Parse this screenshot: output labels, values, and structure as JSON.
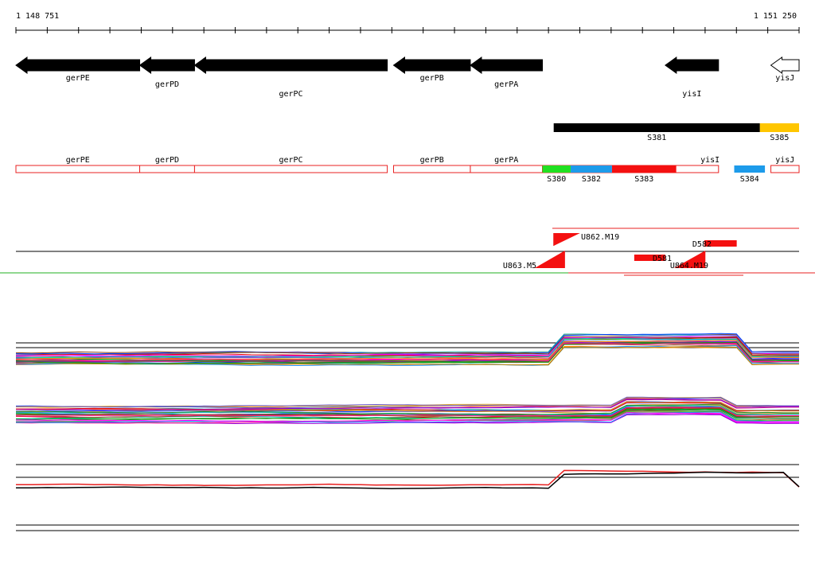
{
  "ruler": {
    "start_label": "1 148 751",
    "end_label": "1 151 250",
    "start": 1148751,
    "end": 1151250
  },
  "genes": [
    {
      "name": "gerPE",
      "start": 1148751,
      "end": 1149146,
      "strand": "-",
      "fill": "#000000"
    },
    {
      "name": "gerPD",
      "start": 1149146,
      "end": 1149321,
      "strand": "-",
      "fill": "#000000"
    },
    {
      "name": "gerPC",
      "start": 1149321,
      "end": 1149936,
      "strand": "-",
      "fill": "#000000"
    },
    {
      "name": "gerPB",
      "start": 1149956,
      "end": 1150201,
      "strand": "-",
      "fill": "#000000"
    },
    {
      "name": "gerPA",
      "start": 1150201,
      "end": 1150431,
      "strand": "-",
      "fill": "#000000"
    },
    {
      "name": "yisI",
      "start": 1150823,
      "end": 1150993,
      "strand": "-",
      "fill": "#000000"
    },
    {
      "name": "yisJ",
      "start": 1151160,
      "end": 1151250,
      "strand": "-",
      "fill": "#ffffff"
    }
  ],
  "segments_top": [
    {
      "name": "S381",
      "start": 1150467,
      "end": 1151125,
      "color": "#000000"
    },
    {
      "name": "S385",
      "start": 1151125,
      "end": 1151250,
      "color": "#ffc600"
    }
  ],
  "gene_boxes": [
    {
      "name": "gerPE",
      "start": 1148751,
      "end": 1149146
    },
    {
      "name": "gerPD",
      "start": 1149146,
      "end": 1149321
    },
    {
      "name": "gerPC",
      "start": 1149321,
      "end": 1149936
    },
    {
      "name": "gerPB",
      "start": 1149956,
      "end": 1150201
    },
    {
      "name": "gerPA",
      "start": 1150201,
      "end": 1150431
    },
    {
      "name": "yisI",
      "start": 1150431,
      "end": 1150993
    },
    {
      "name": "yisJ",
      "start": 1151160,
      "end": 1151250
    }
  ],
  "segments": [
    {
      "name": "S380",
      "start": 1150431,
      "end": 1150521,
      "color": "#21e021"
    },
    {
      "name": "S382",
      "start": 1150521,
      "end": 1150653,
      "color": "#1d9bea"
    },
    {
      "name": "S383",
      "start": 1150653,
      "end": 1150858,
      "color": "#f41010"
    },
    {
      "name": "S384",
      "start": 1151043,
      "end": 1151141,
      "color": "#1d9bea"
    }
  ],
  "probes": [
    {
      "name": "U862.M19",
      "start": 1150467,
      "end": 1150551
    },
    {
      "name": "D582",
      "start": 1150948,
      "end": 1151051
    },
    {
      "name": "D581",
      "start": 1150724,
      "end": 1150823
    },
    {
      "name": "U863.M5",
      "start": 1150406,
      "end": 1150503
    },
    {
      "name": "U864.M19",
      "start": 1150851,
      "end": 1150951
    }
  ],
  "profile_lines": {
    "red": "#e82020",
    "green": "#22b022",
    "black": "#000000",
    "palette": [
      "#e60000",
      "#00a000",
      "#0044ff",
      "#ff00ff",
      "#00c8c8",
      "#ff8c00",
      "#9400d3",
      "#8b4513",
      "#228b22",
      "#ff1493",
      "#4169e1",
      "#daa520",
      "#20b2aa",
      "#a0522d",
      "#6a5acd",
      "#32cd32",
      "#c71585",
      "#1e90ff",
      "#b8860b",
      "#7b68ee"
    ]
  }
}
